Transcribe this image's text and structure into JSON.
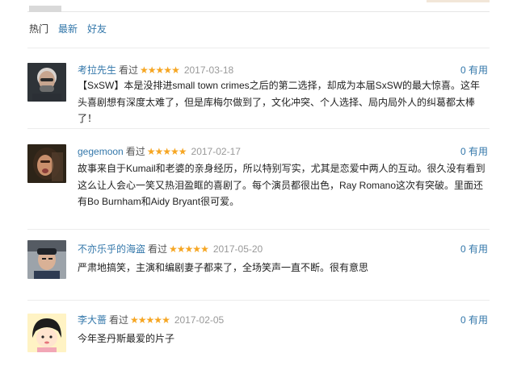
{
  "tabs": [
    {
      "label": "热门"
    },
    {
      "label": "最新"
    },
    {
      "label": "好友"
    }
  ],
  "reviews": [
    {
      "user": "考拉先生",
      "status": "看过",
      "stars": "★★★★★",
      "date": "2017-03-18",
      "useful": "0 有用",
      "text": "【SxSW】本是没排进small town crimes之后的第二选择，却成为本届SxSW的最大惊喜。这年头喜剧想有深度太难了，但是库梅尔做到了，文化冲突、个人选择、局内局外人的纠葛都太棒了！"
    },
    {
      "user": "gegemoon",
      "status": "看过",
      "stars": "★★★★★",
      "date": "2017-02-17",
      "useful": "0 有用",
      "text": "故事来自于Kumail和老婆的亲身经历，所以特别写实，尤其是恋爱中两人的互动。很久没有看到这么让人会心一笑又热泪盈眶的喜剧了。每个演员都很出色，Ray Romano这次有突破。里面还有Bo Burnham和Aidy Bryant很可爱。"
    },
    {
      "user": "不亦乐乎的海盗",
      "status": "看过",
      "stars": "★★★★★",
      "date": "2017-05-20",
      "useful": "0 有用",
      "text": "严肃地搞笑，主演和编剧妻子都来了，全场笑声一直不断。很有意思"
    },
    {
      "user": "李大蔷",
      "status": "看过",
      "stars": "★★★★★",
      "date": "2017-02-05",
      "useful": "0 有用",
      "text": "今年圣丹斯最爱的片子"
    }
  ]
}
